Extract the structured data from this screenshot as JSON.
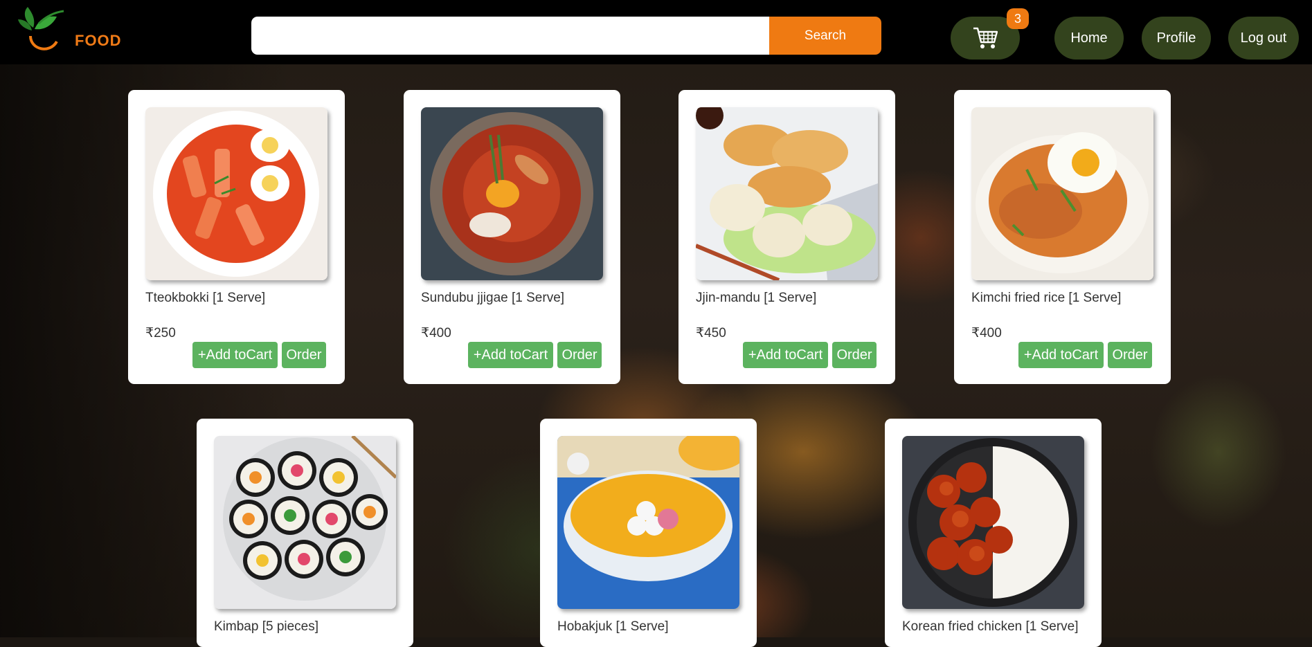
{
  "brand": {
    "logo_text": "FOOD"
  },
  "search": {
    "placeholder": "",
    "value": "",
    "button_label": "Search"
  },
  "cart": {
    "count": "3"
  },
  "nav": {
    "home": "Home",
    "profile": "Profile",
    "logout": "Log out"
  },
  "colors": {
    "header_bg": "#000000",
    "accent": "#ef7a12",
    "nav_bg": "#33431d",
    "button_green": "#5cb35f"
  },
  "products": [
    {
      "name": "Tteokbokki [1 Serve]",
      "price": "₹250",
      "add_label": "+Add toCart",
      "order_label": "Order"
    },
    {
      "name": "Sundubu jjigae [1 Serve]",
      "price": "₹400",
      "add_label": "+Add toCart",
      "order_label": "Order"
    },
    {
      "name": "Jjin-mandu [1 Serve]",
      "price": "₹450",
      "add_label": "+Add toCart",
      "order_label": "Order"
    },
    {
      "name": "Kimchi fried rice [1 Serve]",
      "price": "₹400",
      "add_label": "+Add toCart",
      "order_label": "Order"
    },
    {
      "name": "Kimbap [5 pieces]"
    },
    {
      "name": "Hobakjuk [1 Serve]"
    },
    {
      "name": "Korean fried chicken [1 Serve]"
    }
  ]
}
